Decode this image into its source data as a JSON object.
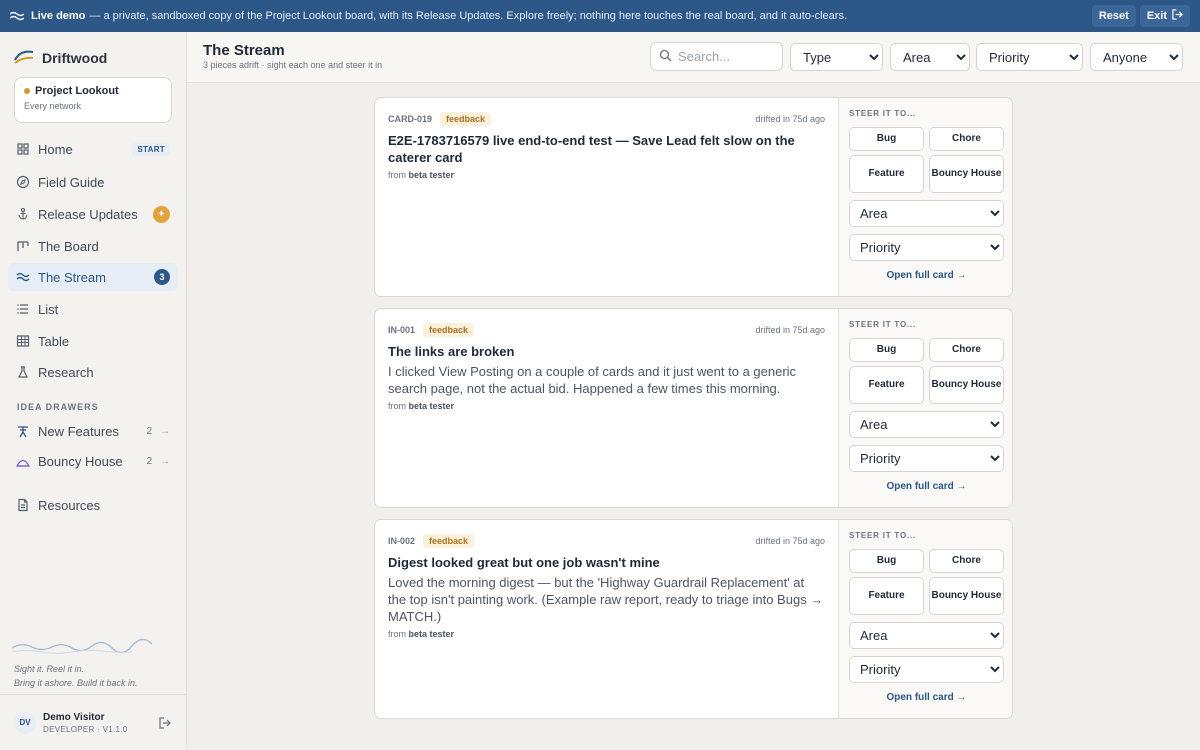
{
  "banner": {
    "lead": "Live demo",
    "text": "— a private, sandboxed copy of the Project Lookout board, with its Release Updates. Explore freely; nothing here touches the real board, and it auto-clears.",
    "reset_label": "Reset",
    "exit_label": "Exit"
  },
  "sidebar": {
    "brand": "Driftwood",
    "workspace": {
      "name": "Project Lookout",
      "sub": "Every network"
    },
    "nav": [
      {
        "label": "Home",
        "icon": "home-icon",
        "tag": "START"
      },
      {
        "label": "Field Guide",
        "icon": "compass-icon"
      },
      {
        "label": "Release Updates",
        "icon": "anchor-icon"
      },
      {
        "label": "The Board",
        "icon": "board-icon"
      },
      {
        "label": "The Stream",
        "icon": "wave-icon",
        "count": "3"
      },
      {
        "label": "List",
        "icon": "list-icon"
      },
      {
        "label": "Table",
        "icon": "table-icon"
      },
      {
        "label": "Research",
        "icon": "flask-icon"
      }
    ],
    "drawers_heading": "IDEA DRAWERS",
    "drawers": [
      {
        "label": "New Features",
        "count": "2"
      },
      {
        "label": "Bouncy House",
        "count": "2"
      }
    ],
    "resources_label": "Resources",
    "tagline_1": "Sight it. Reel it in.",
    "tagline_2": "Bring it ashore. Build it back in.",
    "user": {
      "initials": "DV",
      "name": "Demo Visitor",
      "role": "DEVELOPER · V1.1.0"
    }
  },
  "header": {
    "title": "The Stream",
    "subtitle": "3 pieces adrift · sight each one and steer it in",
    "search_placeholder": "Search...",
    "filters": {
      "type": "Type",
      "area": "Area",
      "priority": "Priority",
      "assignee": "Anyone"
    }
  },
  "steer": {
    "label": "STEER IT TO...",
    "bug": "Bug",
    "chore": "Chore",
    "feature": "Feature",
    "bouncy": "Bouncy House",
    "area": "Area",
    "priority": "Priority",
    "open_link": "Open full card →"
  },
  "cards": [
    {
      "id": "CARD-019",
      "tag": "feedback",
      "time": "drifted in 75d ago",
      "title": "E2E-1783716579 live end-to-end test — Save Lead felt slow on the caterer card",
      "body": "",
      "from_prefix": "from",
      "from": "beta tester"
    },
    {
      "id": "IN-001",
      "tag": "feedback",
      "time": "drifted in 75d ago",
      "title": "The links are broken",
      "body": "I clicked View Posting on a couple of cards and it just went to a generic search page, not the actual bid. Happened a few times this morning.",
      "from_prefix": "from",
      "from": "beta tester"
    },
    {
      "id": "IN-002",
      "tag": "feedback",
      "time": "drifted in 75d ago",
      "title": "Digest looked great but one job wasn't mine",
      "body": "Loved the morning digest — but the 'Highway Guardrail Replacement' at the top isn't painting work. (Example raw report, ready to triage into Bugs → MATCH.)",
      "from_prefix": "from",
      "from": "beta tester"
    }
  ]
}
